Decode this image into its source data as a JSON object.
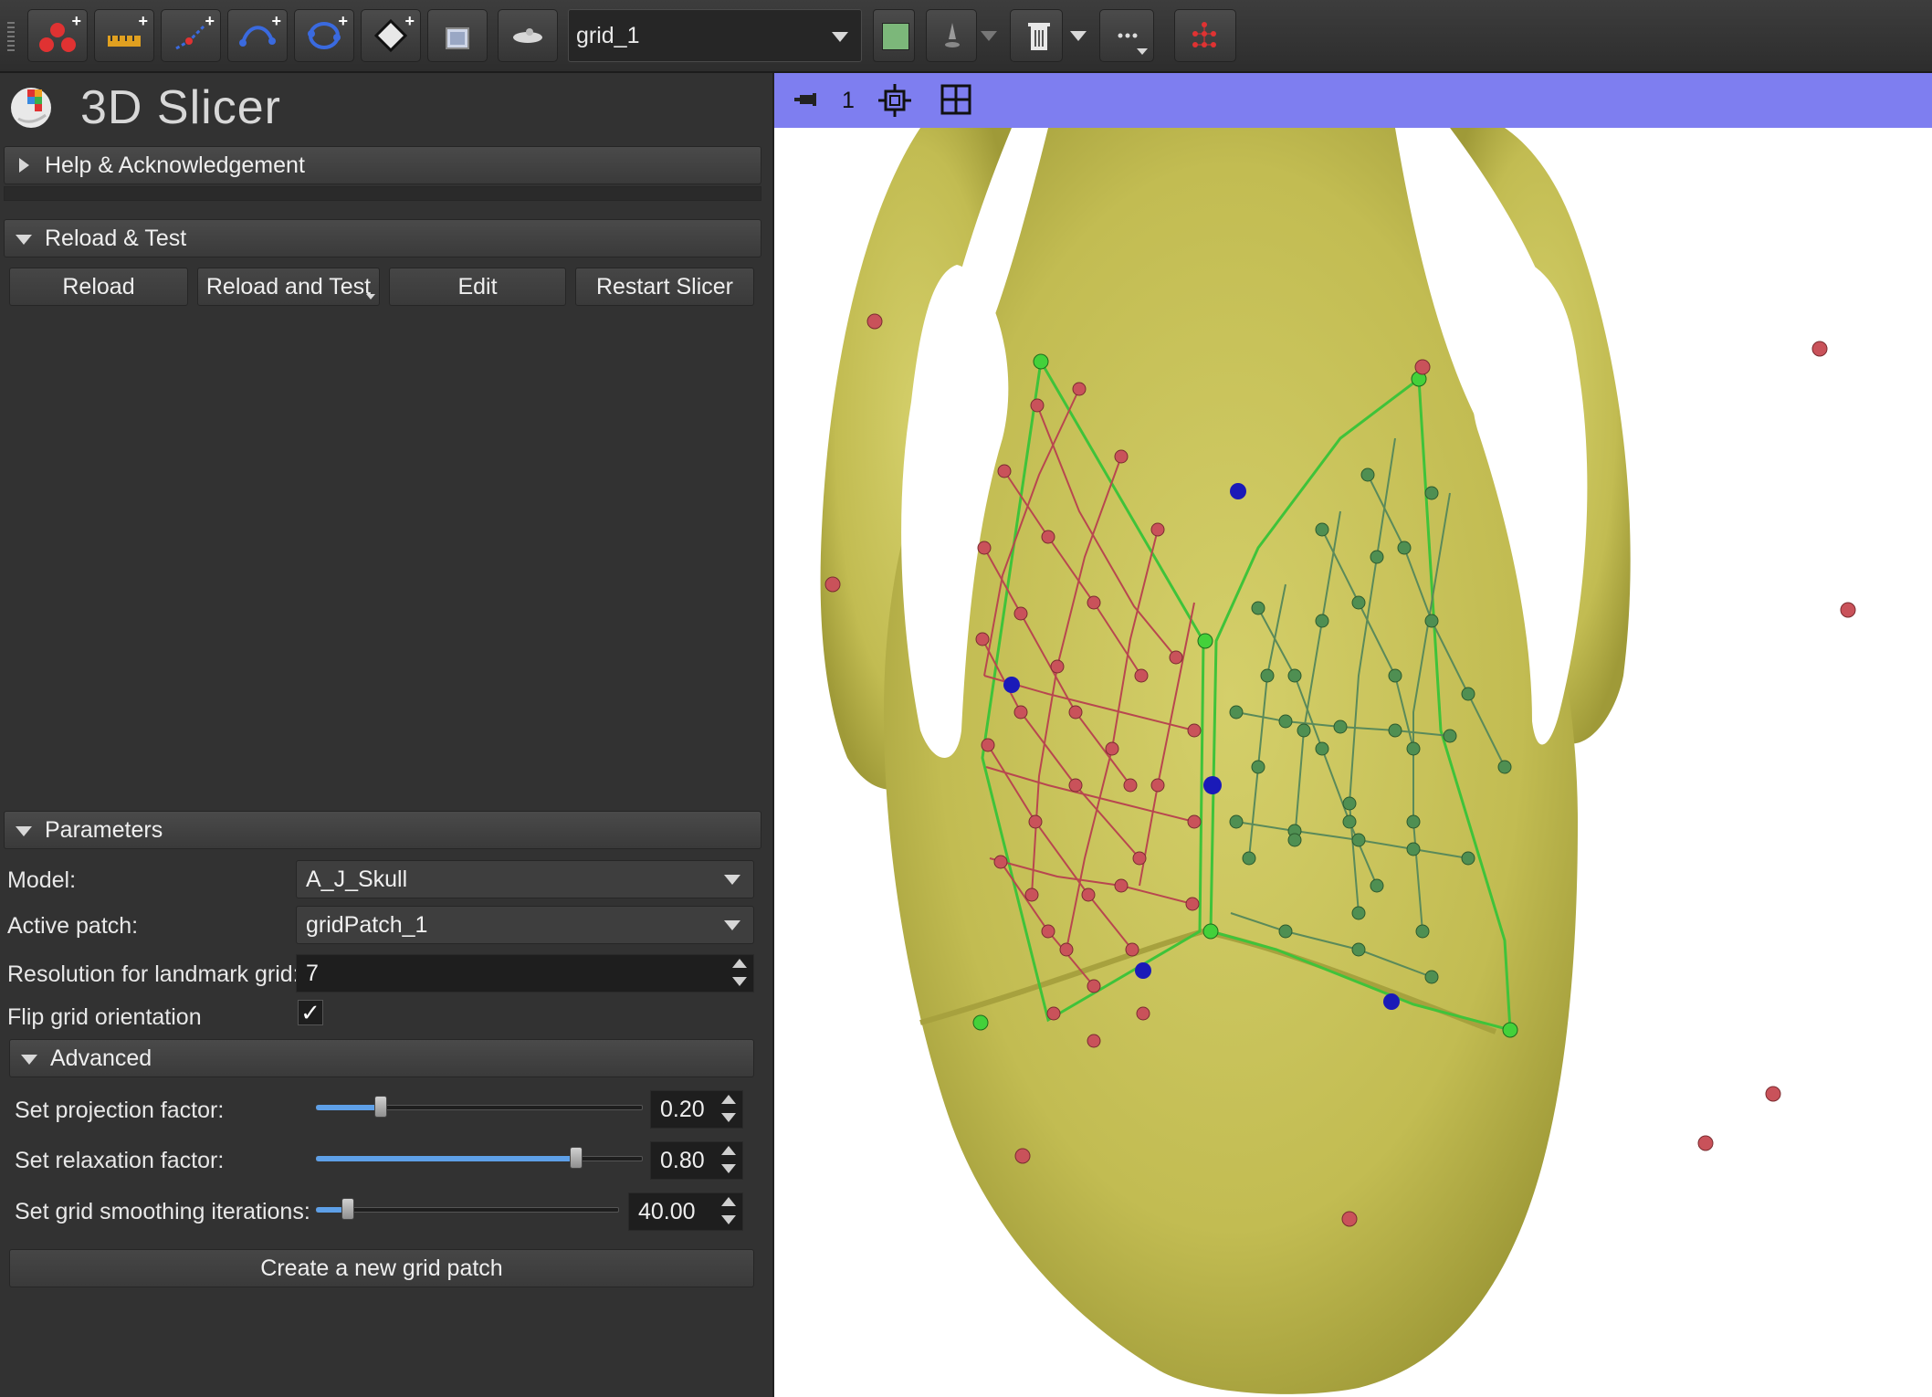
{
  "toolbar": {
    "node_selector": "grid_1",
    "buttons": [
      {
        "name": "place-fiducial-icon"
      },
      {
        "name": "place-line-icon"
      },
      {
        "name": "place-angle-icon"
      },
      {
        "name": "place-curve-icon"
      },
      {
        "name": "place-closed-curve-icon"
      },
      {
        "name": "place-plane-icon"
      },
      {
        "name": "place-roi-icon"
      },
      {
        "name": "place-mode-icon"
      }
    ],
    "color_swatch": "#7cb77a"
  },
  "app": {
    "title": "3D Slicer"
  },
  "sections": {
    "help": "Help & Acknowledgement",
    "reload": "Reload & Test",
    "parameters": "Parameters",
    "advanced": "Advanced"
  },
  "reload_buttons": {
    "reload": "Reload",
    "reload_test": "Reload and Test",
    "edit": "Edit",
    "restart": "Restart Slicer"
  },
  "params": {
    "model_label": "Model:",
    "model_value": "A_J_Skull",
    "patch_label": "Active patch:",
    "patch_value": "gridPatch_1",
    "resolution_label": "Resolution for landmark grid:",
    "resolution_value": "7",
    "flip_label": "Flip grid orientation",
    "flip_checked": true
  },
  "advanced": {
    "projection_label": "Set projection factor:",
    "projection_value": "0.20",
    "projection_fraction": 0.2,
    "relaxation_label": "Set relaxation factor:",
    "relaxation_value": "0.80",
    "relaxation_fraction": 0.8,
    "smoothing_label": "Set grid smoothing iterations:",
    "smoothing_value": "40.00"
  },
  "create_button": "Create a new grid patch",
  "view": {
    "index": "1",
    "bar_color": "#7e7ef0",
    "model_color": "#c9c45c"
  }
}
